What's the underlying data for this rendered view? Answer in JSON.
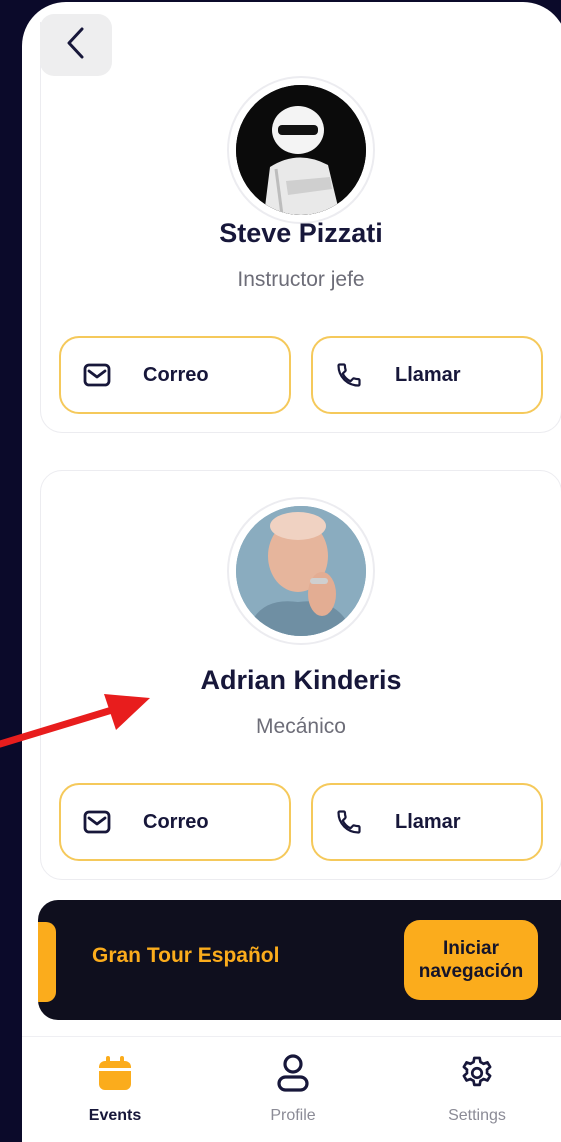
{
  "contacts": [
    {
      "name": "Steve Pizzati",
      "role": "Instructor jefe",
      "email_label": "Correo",
      "call_label": "Llamar",
      "avatar_icon": "helmet-driver-avatar"
    },
    {
      "name": "Adrian Kinderis",
      "role": "Mecánico",
      "email_label": "Correo",
      "call_label": "Llamar",
      "avatar_icon": "person-avatar"
    }
  ],
  "banner": {
    "title": "Gran Tour Español",
    "button_label": "Iniciar navegación"
  },
  "tabs": [
    {
      "label": "Events",
      "icon": "calendar-icon",
      "active": true
    },
    {
      "label": "Profile",
      "icon": "user-icon",
      "active": false
    },
    {
      "label": "Settings",
      "icon": "gear-icon",
      "active": false
    }
  ],
  "colors": {
    "accent": "#fbac1c",
    "button_border": "#f5c95b",
    "text_dark": "#17173a",
    "background": "#0b0a2a",
    "banner_bg": "#0f0f1e",
    "annotation_arrow": "#e81d1d"
  }
}
